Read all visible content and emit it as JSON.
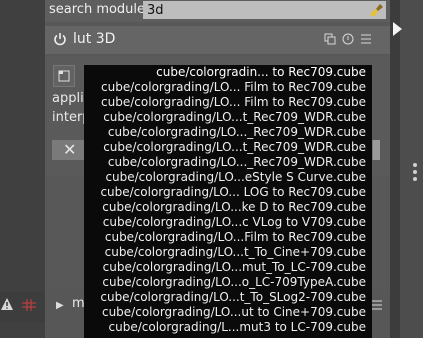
{
  "search": {
    "label": "search module",
    "value": "3d"
  },
  "module": {
    "title": "lut 3D"
  },
  "labels": {
    "application": "applic",
    "interpolation": "interp",
    "bottom_module": "m"
  },
  "dropdown": {
    "items": [
      "cube/colorgradin... to Rec709.cube",
      "cube/colorgrading/LO... Film to Rec709.cube",
      "cube/colorgrading/LO... Film to Rec709.cube",
      "cube/colorgrading/LO...t_Rec709_WDR.cube",
      "cube/colorgrading/LO..._Rec709_WDR.cube",
      "cube/colorgrading/LO...t_Rec709_WDR.cube",
      "cube/colorgrading/LO..._Rec709_WDR.cube",
      "cube/colorgrading/LO...eStyle S Curve.cube",
      "cube/colorgrading/LO... LOG to Rec709.cube",
      "cube/colorgrading/LO...ke D to Rec709.cube",
      "cube/colorgrading/LO...c VLog to V709.cube",
      "cube/colorgrading/LO...Film to Rec709.cube",
      "cube/colorgrading/LO...t_To_Cine+709.cube",
      "cube/colorgrading/LO...mut_To_LC-709.cube",
      "cube/colorgrading/LO...o_LC-709TypeA.cube",
      "cube/colorgrading/LO...t_To_SLog2-709.cube",
      "cube/colorgrading/LO...ut to Cine+709.cube",
      "cube/colorgrading/L...mut3 to LC-709.cube"
    ]
  },
  "colors": {
    "panel_bg": "#585858",
    "dropdown_bg": "#0a0a0a",
    "search_field_bg": "#bdbdbd",
    "warning": "#e0c020",
    "grid_icon": "#d04040"
  },
  "icons": {
    "search_clear": "broom-icon",
    "module_power": "power-icon",
    "preset": "presets-icon",
    "reset": "reset-icon",
    "menu": "hamburger-icon"
  }
}
